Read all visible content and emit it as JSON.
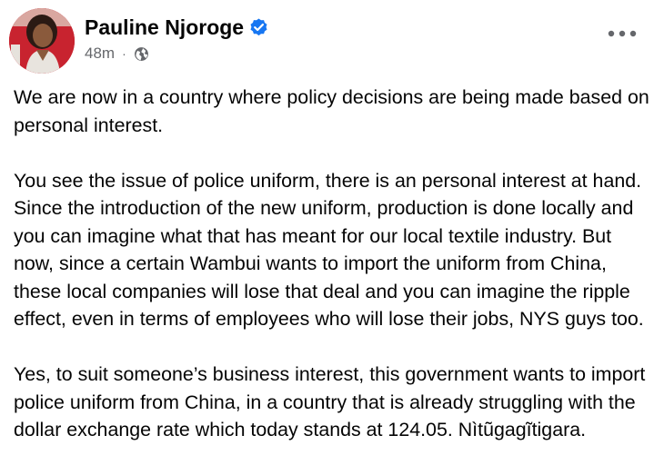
{
  "post": {
    "author": {
      "name": "Pauline Njoroge",
      "verified": true
    },
    "timestamp": "48m",
    "separator": "·",
    "audience_icon": "globe-icon",
    "more_icon": "more-options-icon",
    "paragraphs": [
      "We are now in a country where policy decisions are being made based on personal interest.",
      "You see the issue of police uniform, there is an personal interest at hand. Since the introduction of the new uniform, production is done locally and you can imagine what that has meant for our local textile industry. But now, since a certain Wambui wants to import the uniform from China, these local companies will lose that deal and you can imagine the ripple effect, even in terms of employees who will lose their jobs, NYS guys too.",
      "Yes, to suit someone’s business interest, this government wants to import police uniform from China, in a country that is already struggling with the dollar exchange rate which today stands at 124.05. Nìtũgagĩtigara."
    ]
  },
  "colors": {
    "text": "#050505",
    "secondary": "#65676b",
    "verified": "#1877f2",
    "avatar_bg": "#c8232f"
  }
}
